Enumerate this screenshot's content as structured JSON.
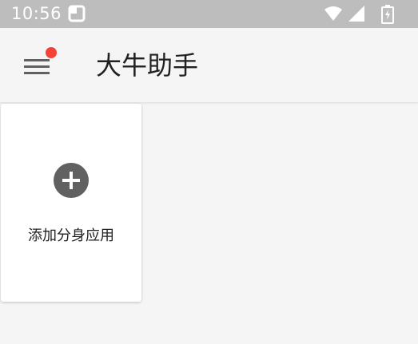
{
  "status_bar": {
    "time": "10:56",
    "icons": [
      "notification-icon",
      "wifi-icon",
      "signal-icon",
      "battery-icon"
    ]
  },
  "app_bar": {
    "menu_icon": "hamburger-menu-icon",
    "title": "大牛助手",
    "badge_color": "#f44336"
  },
  "main": {
    "add_card": {
      "icon": "add-circle-icon",
      "label": "添加分身应用"
    }
  },
  "colors": {
    "status_bar_bg": "#bdbdbd",
    "background": "#f5f5f5",
    "card_bg": "#ffffff",
    "icon_gray": "#616161",
    "text": "#212121"
  }
}
